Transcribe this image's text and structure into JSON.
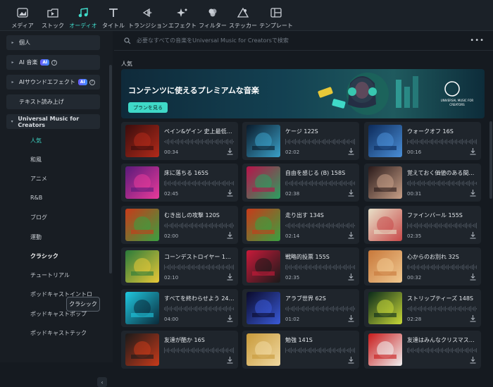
{
  "toolbar": [
    {
      "label": "メディア",
      "icon": "media-icon",
      "active": false
    },
    {
      "label": "ストック",
      "icon": "stock-icon",
      "active": false
    },
    {
      "label": "オーディオ",
      "icon": "music-note-icon",
      "active": true
    },
    {
      "label": "タイトル",
      "icon": "title-t-icon",
      "active": false
    },
    {
      "label": "トランジション",
      "icon": "transition-icon",
      "active": false
    },
    {
      "label": "エフェクト",
      "icon": "effect-sparkle-icon",
      "active": false
    },
    {
      "label": "フィルター",
      "icon": "filter-icon",
      "active": false
    },
    {
      "label": "ステッカー",
      "icon": "sticker-icon",
      "active": false
    },
    {
      "label": "テンプレート",
      "icon": "template-icon",
      "active": false
    }
  ],
  "sidebar": {
    "groups": [
      {
        "label": "個人",
        "arrow": "▸",
        "badge": "",
        "help": false
      },
      {
        "label": "AI 音楽",
        "arrow": "▸",
        "badge": "AI",
        "help": true
      },
      {
        "label": "AIサウンドエフェクト",
        "arrow": "▸",
        "badge": "AI",
        "help": true
      },
      {
        "label": "テキスト読み上げ",
        "arrow": "",
        "badge": "",
        "help": false
      },
      {
        "label": "Universal Music for Creators",
        "arrow": "▾",
        "badge": "",
        "help": false
      }
    ],
    "subitems": [
      {
        "label": "人気",
        "state": "active"
      },
      {
        "label": "和風",
        "state": ""
      },
      {
        "label": "アニメ",
        "state": ""
      },
      {
        "label": "R&B",
        "state": ""
      },
      {
        "label": "ブログ",
        "state": ""
      },
      {
        "label": "運動",
        "state": ""
      },
      {
        "label": "クラシック",
        "state": "bold"
      },
      {
        "label": "チュートリアル",
        "state": ""
      },
      {
        "label": "ポッドキャストイントロ",
        "state": ""
      },
      {
        "label": "ポッドキャストポップ",
        "state": ""
      },
      {
        "label": "ポッドキャストテック",
        "state": ""
      }
    ],
    "tooltip": "クラシック",
    "collapse_icon": "chevron-left-icon"
  },
  "search": {
    "placeholder": "必要なすべての音楽をUniversal Music for Creatorsで検索"
  },
  "section_title": "人気",
  "banner": {
    "title": "コンテンツに使えるプレミアムな音楽",
    "button": "プランを見る",
    "logo_text": "UNIVERSAL MUSIC FOR CREATORS"
  },
  "tracks": [
    {
      "title": "ペイン&ゲイン 史上最低の...",
      "duration": "00:34",
      "art": [
        "#3a0d0d",
        "#b22a1a"
      ]
    },
    {
      "title": "ケージ 122S",
      "duration": "02:02",
      "art": [
        "#0a1a2a",
        "#3aa0c8"
      ]
    },
    {
      "title": "ウォークオフ 16S",
      "duration": "00:16",
      "art": [
        "#0c2a5a",
        "#4a8fd8"
      ]
    },
    {
      "title": "床に落ちる 165S",
      "duration": "02:45",
      "art": [
        "#5a1a7a",
        "#e83a9a"
      ]
    },
    {
      "title": "自由を感じる (B) 158S",
      "duration": "02:38",
      "art": [
        "#b8124a",
        "#2aa060"
      ]
    },
    {
      "title": "覚えておく価値のある間違い...",
      "duration": "00:31",
      "art": [
        "#2a1a1a",
        "#c8a088"
      ]
    },
    {
      "title": "むき出しの攻撃 120S",
      "duration": "02:00",
      "art": [
        "#c83a1a",
        "#3aa040"
      ]
    },
    {
      "title": "走り出す 134S",
      "duration": "02:14",
      "art": [
        "#c83a1a",
        "#3aa040"
      ]
    },
    {
      "title": "ファインバール 155S",
      "duration": "02:35",
      "art": [
        "#e8e0c8",
        "#c84a4a"
      ]
    },
    {
      "title": "コーンデストロイヤー 130S",
      "duration": "02:10",
      "art": [
        "#2a7a3a",
        "#e8c838"
      ]
    },
    {
      "title": "戦略的投票 155S",
      "duration": "02:35",
      "art": [
        "#c81a3a",
        "#1a1a1a"
      ]
    },
    {
      "title": "心からのお別れ 32S",
      "duration": "00:32",
      "art": [
        "#c8783a",
        "#f0c890"
      ]
    },
    {
      "title": "すべてを終わらせよう 240S",
      "duration": "04:00",
      "art": [
        "#20c8e0",
        "#0a2a3a"
      ]
    },
    {
      "title": "アラブ世界 62S",
      "duration": "01:02",
      "art": [
        "#0a0a2a",
        "#3a5ad8"
      ]
    },
    {
      "title": "ストリップティーズ 148S",
      "duration": "02:28",
      "art": [
        "#0a2a1a",
        "#c8d838"
      ]
    },
    {
      "title": "友達が酷か 16S",
      "duration": "",
      "art": [
        "#1a1a1a",
        "#c83a1a"
      ]
    },
    {
      "title": "勉強 141S",
      "duration": "",
      "art": [
        "#c89a3a",
        "#f0d8a0"
      ]
    },
    {
      "title": "友達はみんなクリスマスに...",
      "duration": "",
      "art": [
        "#c81a1a",
        "#f0f0f0"
      ]
    }
  ]
}
